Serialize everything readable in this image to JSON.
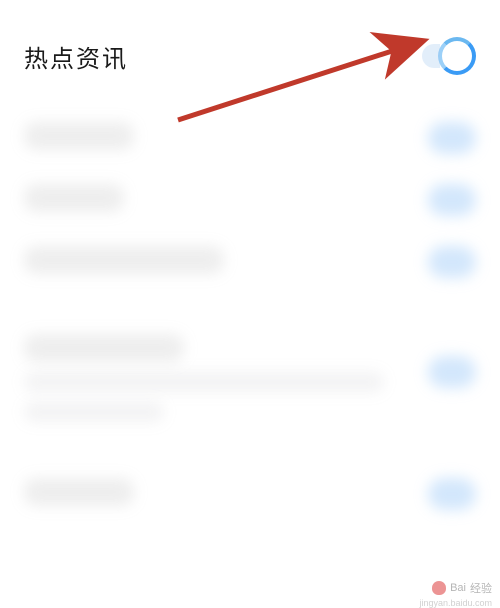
{
  "settings": {
    "row0": {
      "label": "热点资讯",
      "toggle_on": true
    }
  },
  "annotation": {
    "arrow_color": "#c0392b"
  },
  "watermark": {
    "brand": "Bai",
    "suffix": "经验",
    "url": "jingyan.baidu.com"
  }
}
